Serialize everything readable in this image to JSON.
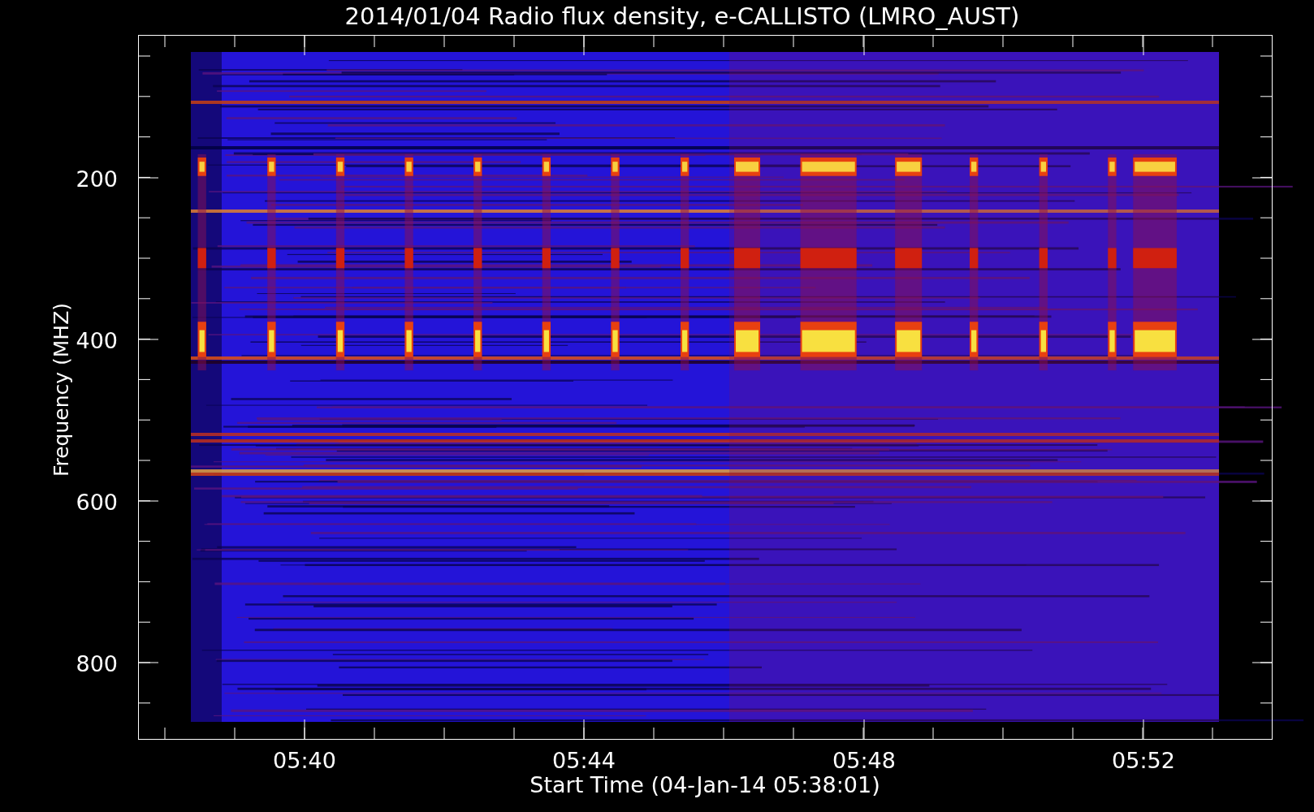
{
  "plot": {
    "title": "2014/01/04  Radio flux density, e-CALLISTO (LMRO_AUST)",
    "ylabel": "Frequency (MHZ)",
    "xlabel": "Start Time (04-Jan-14 05:38:01)",
    "yticks": [
      "200",
      "400",
      "600",
      "800"
    ],
    "xticks": [
      "05:40",
      "05:44",
      "05:48",
      "05:52"
    ]
  }
}
